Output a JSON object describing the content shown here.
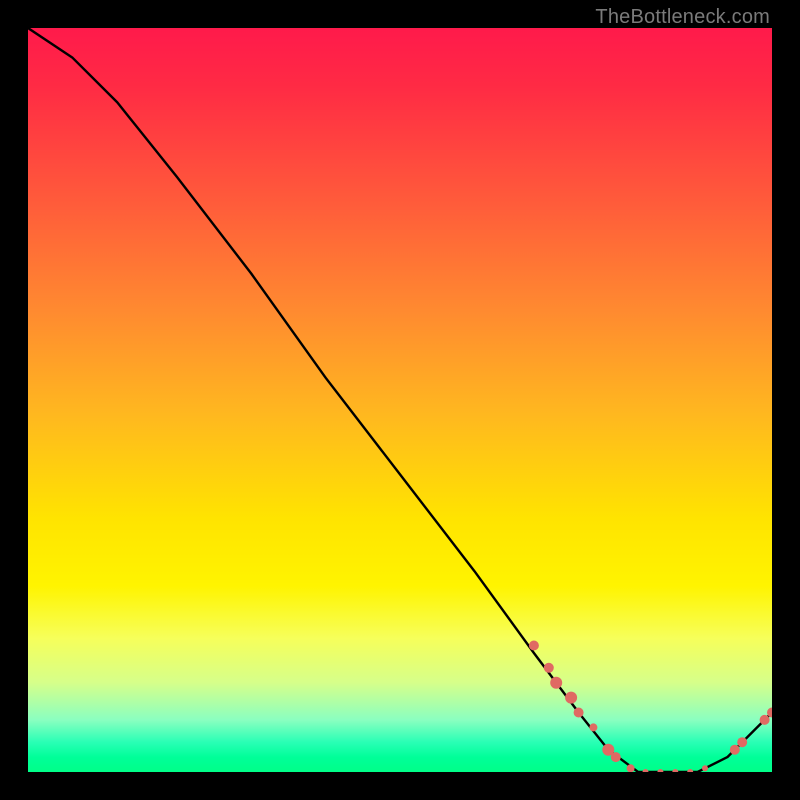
{
  "watermark": "TheBottleneck.com",
  "chart_data": {
    "type": "line",
    "title": "",
    "xlabel": "",
    "ylabel": "",
    "xlim": [
      0,
      100
    ],
    "ylim": [
      0,
      100
    ],
    "curve": {
      "name": "bottleneck-curve",
      "x": [
        0,
        6,
        12,
        20,
        30,
        40,
        50,
        60,
        68,
        74,
        78,
        82,
        86,
        90,
        94,
        98,
        100
      ],
      "y": [
        100,
        96,
        90,
        80,
        67,
        53,
        40,
        27,
        16,
        8,
        3,
        0,
        0,
        0,
        2,
        6,
        8
      ]
    },
    "points": {
      "name": "highlight-points",
      "color": "#e06a63",
      "items": [
        {
          "x": 68,
          "y": 17,
          "r": 5
        },
        {
          "x": 70,
          "y": 14,
          "r": 5
        },
        {
          "x": 71,
          "y": 12,
          "r": 6
        },
        {
          "x": 73,
          "y": 10,
          "r": 6
        },
        {
          "x": 74,
          "y": 8,
          "r": 5
        },
        {
          "x": 76,
          "y": 6,
          "r": 4
        },
        {
          "x": 78,
          "y": 3,
          "r": 6
        },
        {
          "x": 79,
          "y": 2,
          "r": 5
        },
        {
          "x": 81,
          "y": 0.5,
          "r": 4
        },
        {
          "x": 83,
          "y": 0,
          "r": 3
        },
        {
          "x": 85,
          "y": 0,
          "r": 3
        },
        {
          "x": 87,
          "y": 0,
          "r": 3
        },
        {
          "x": 89,
          "y": 0,
          "r": 3
        },
        {
          "x": 91,
          "y": 0.5,
          "r": 3
        },
        {
          "x": 95,
          "y": 3,
          "r": 5
        },
        {
          "x": 96,
          "y": 4,
          "r": 5
        },
        {
          "x": 99,
          "y": 7,
          "r": 5
        },
        {
          "x": 100,
          "y": 8,
          "r": 5
        }
      ]
    }
  }
}
